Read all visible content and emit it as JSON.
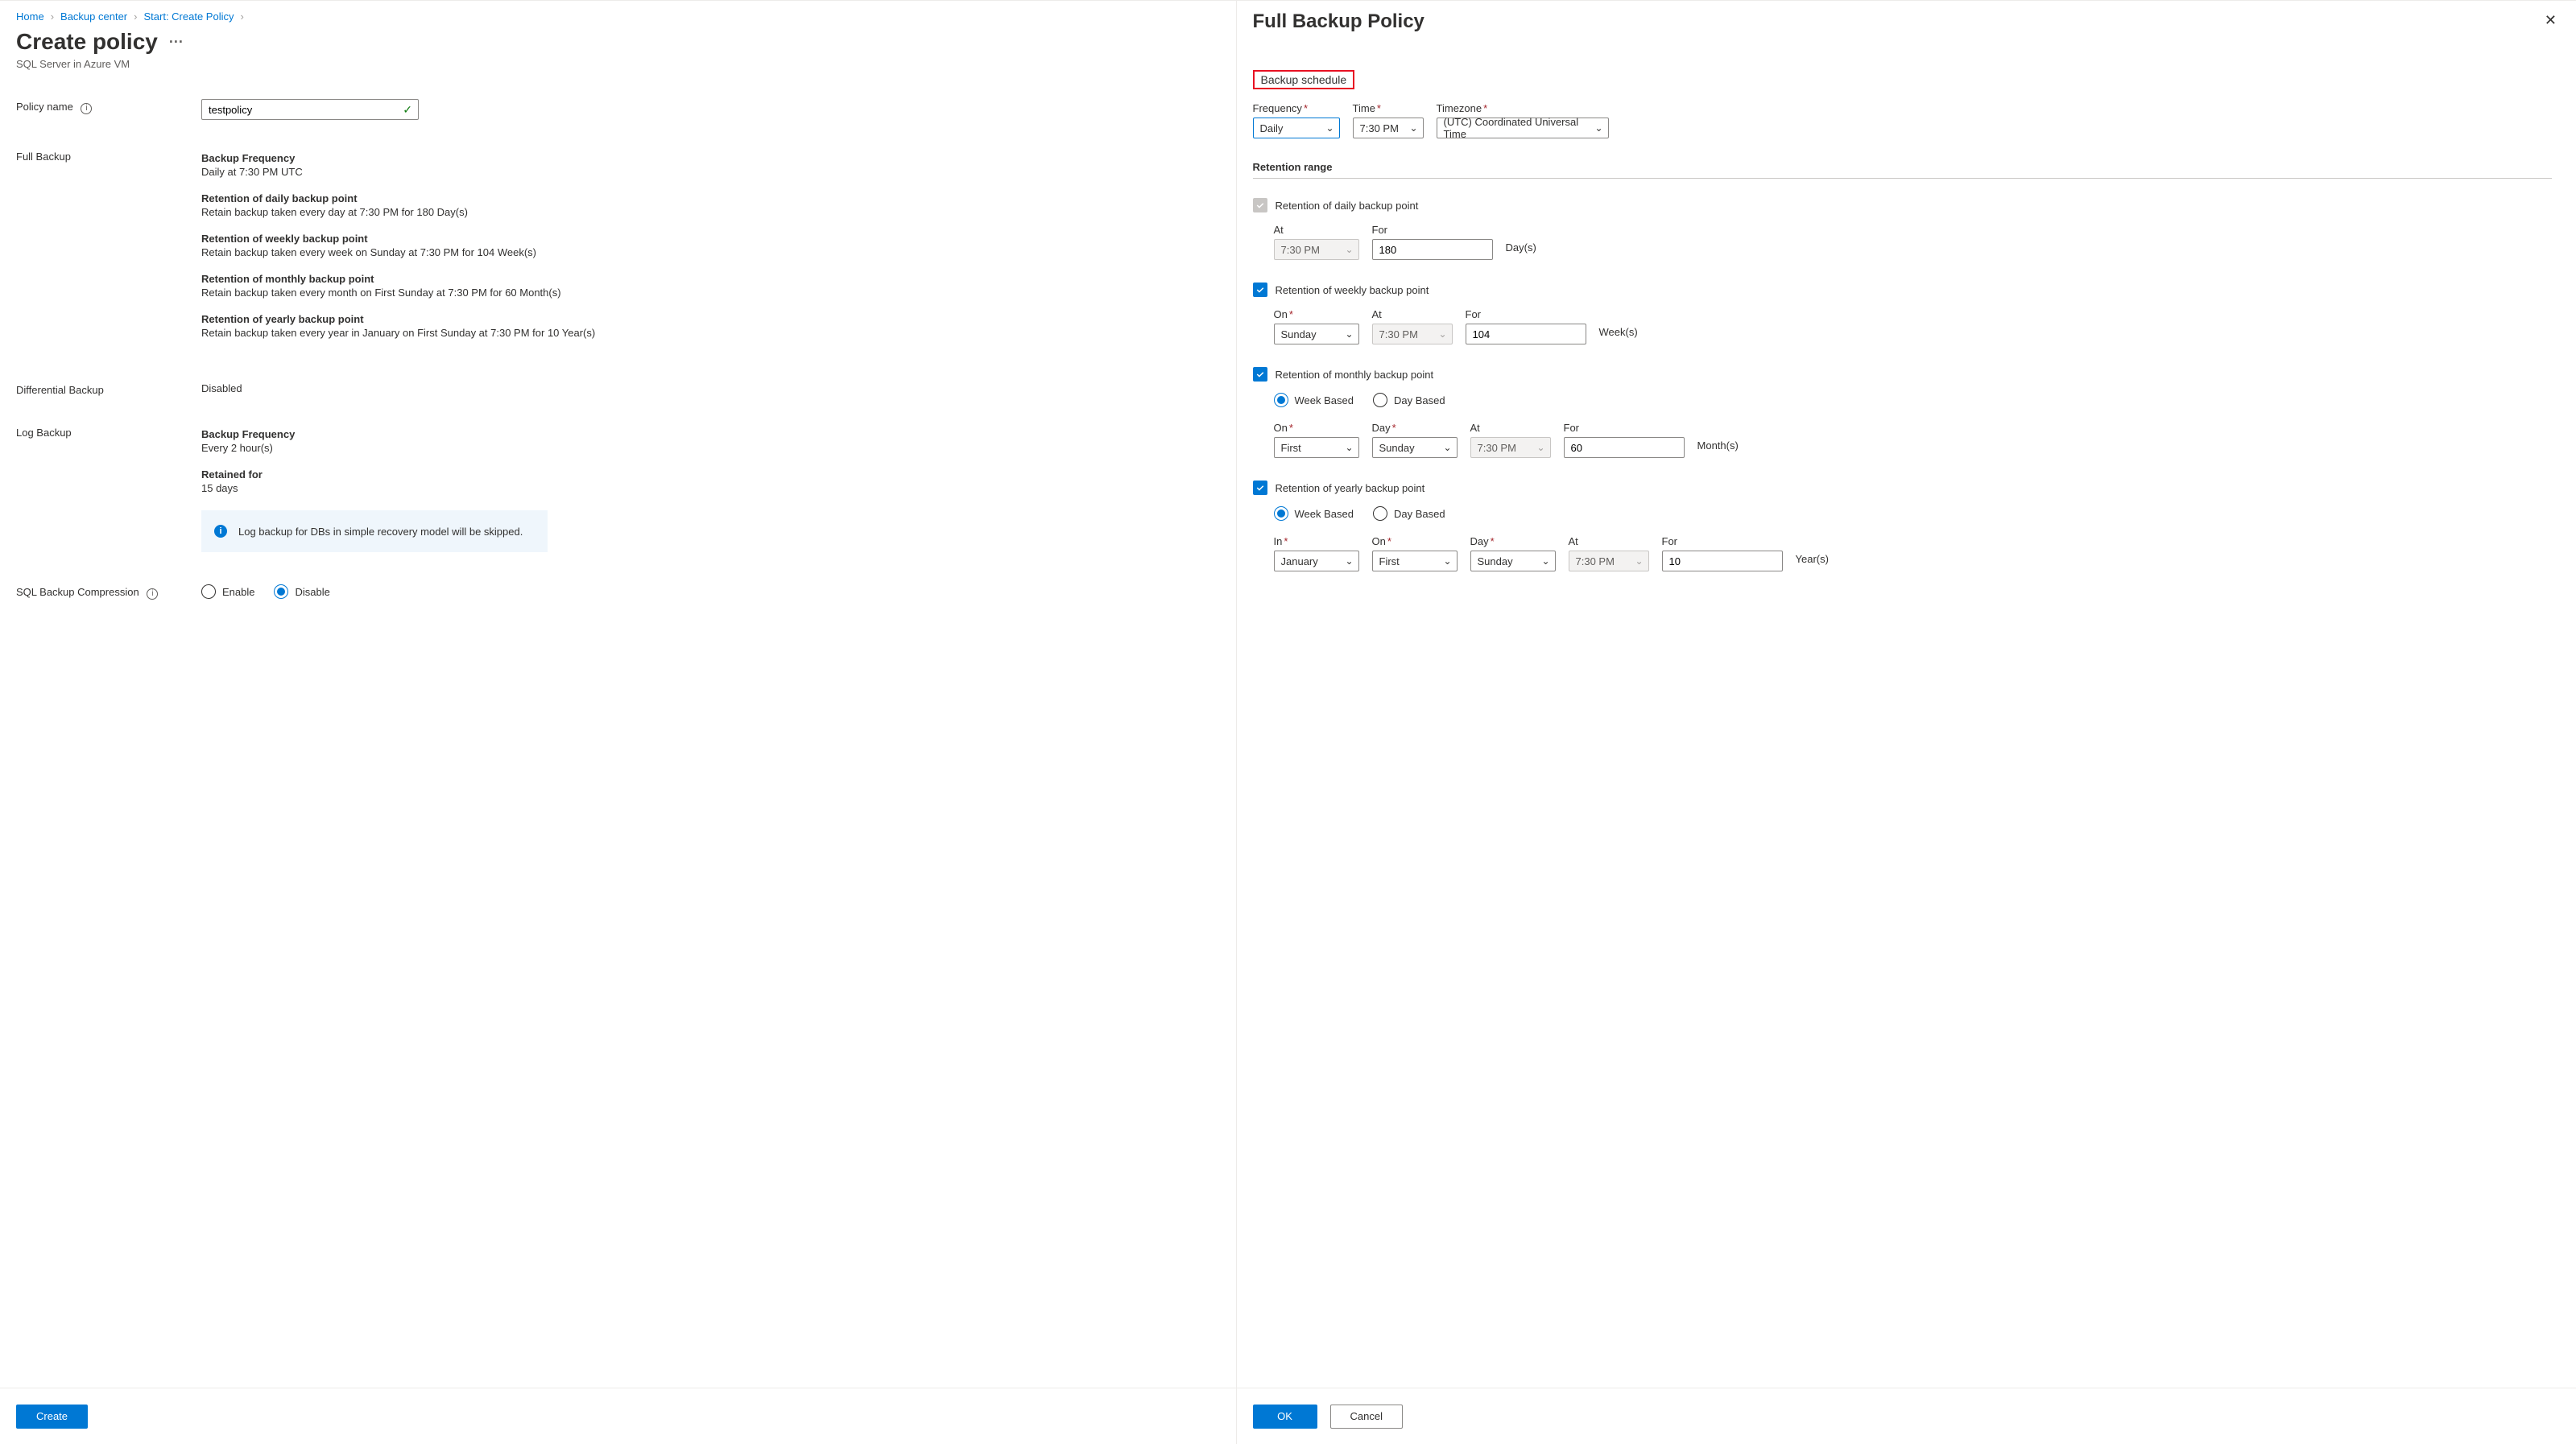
{
  "breadcrumb": {
    "home": "Home",
    "backup_center": "Backup center",
    "start": "Start: Create Policy"
  },
  "page": {
    "title": "Create policy",
    "subtitle": "SQL Server in Azure VM"
  },
  "form": {
    "policy_name_label": "Policy name",
    "policy_name_value": "testpolicy",
    "full_backup_label": "Full Backup",
    "full": {
      "freq_title": "Backup Frequency",
      "freq_text": "Daily at 7:30 PM UTC",
      "daily_title": "Retention of daily backup point",
      "daily_text": "Retain backup taken every day at 7:30 PM for 180 Day(s)",
      "weekly_title": "Retention of weekly backup point",
      "weekly_text": "Retain backup taken every week on Sunday at 7:30 PM for 104 Week(s)",
      "monthly_title": "Retention of monthly backup point",
      "monthly_text": "Retain backup taken every month on First Sunday at 7:30 PM for 60 Month(s)",
      "yearly_title": "Retention of yearly backup point",
      "yearly_text": "Retain backup taken every year in January on First Sunday at 7:30 PM for 10 Year(s)"
    },
    "diff_label": "Differential Backup",
    "diff_value": "Disabled",
    "log_label": "Log Backup",
    "log": {
      "freq_title": "Backup Frequency",
      "freq_text": "Every 2 hour(s)",
      "ret_title": "Retained for",
      "ret_text": "15 days"
    },
    "callout": "Log backup for DBs in simple recovery model will be skipped.",
    "compress_label": "SQL Backup Compression",
    "compress": {
      "enable": "Enable",
      "disable": "Disable"
    }
  },
  "panel": {
    "title": "Full Backup Policy",
    "schedule_heading": "Backup schedule",
    "schedule": {
      "frequency_label": "Frequency",
      "frequency_value": "Daily",
      "time_label": "Time",
      "time_value": "7:30 PM",
      "tz_label": "Timezone",
      "tz_value": "(UTC) Coordinated Universal Time"
    },
    "retention_heading": "Retention range",
    "daily": {
      "label": "Retention of daily backup point",
      "at_label": "At",
      "at_value": "7:30 PM",
      "for_label": "For",
      "for_value": "180",
      "unit": "Day(s)"
    },
    "weekly": {
      "label": "Retention of weekly backup point",
      "on_label": "On",
      "on_value": "Sunday",
      "at_label": "At",
      "at_value": "7:30 PM",
      "for_label": "For",
      "for_value": "104",
      "unit": "Week(s)"
    },
    "monthly": {
      "label": "Retention of monthly backup point",
      "week_based": "Week Based",
      "day_based": "Day Based",
      "on_label": "On",
      "on_value": "First",
      "day_label": "Day",
      "day_value": "Sunday",
      "at_label": "At",
      "at_value": "7:30 PM",
      "for_label": "For",
      "for_value": "60",
      "unit": "Month(s)"
    },
    "yearly": {
      "label": "Retention of yearly backup point",
      "week_based": "Week Based",
      "day_based": "Day Based",
      "in_label": "In",
      "in_value": "January",
      "on_label": "On",
      "on_value": "First",
      "day_label": "Day",
      "day_value": "Sunday",
      "at_label": "At",
      "at_value": "7:30 PM",
      "for_label": "For",
      "for_value": "10",
      "unit": "Year(s)"
    },
    "ok": "OK",
    "cancel": "Cancel"
  },
  "footer": {
    "create": "Create"
  }
}
